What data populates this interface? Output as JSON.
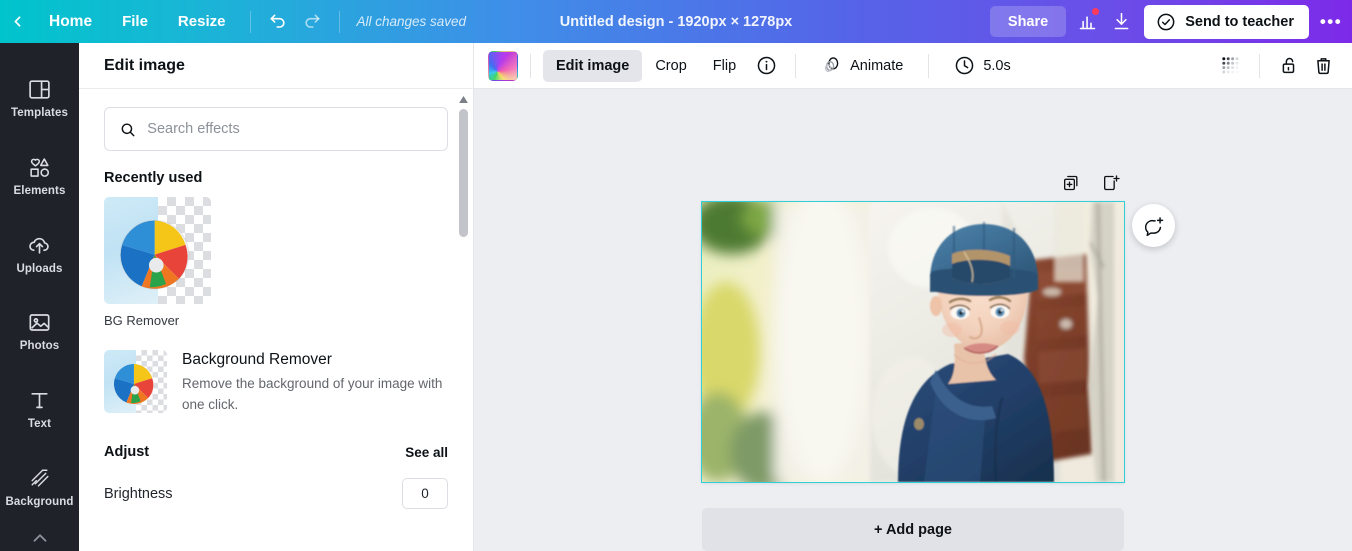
{
  "topbar": {
    "back_label": "back-chevron",
    "home_label": "Home",
    "file_label": "File",
    "resize_label": "Resize",
    "undo_label": "undo-icon",
    "redo_label": "redo-icon",
    "save_status": "All changes saved",
    "design_title": "Untitled design - 1920px × 1278px",
    "share_label": "Share",
    "insights_label": "insights-icon",
    "download_label": "download-icon",
    "send_to_teacher_label": "Send to teacher",
    "more_label": "•••",
    "gradient_start": "#00c4cc",
    "gradient_end": "#7d2ae8",
    "notification_color": "#ff3b5c"
  },
  "rail": {
    "items": [
      {
        "label": "Templates",
        "icon": "templates-icon"
      },
      {
        "label": "Elements",
        "icon": "elements-icon"
      },
      {
        "label": "Uploads",
        "icon": "uploads-icon"
      },
      {
        "label": "Photos",
        "icon": "photos-icon"
      },
      {
        "label": "Text",
        "icon": "text-icon"
      },
      {
        "label": "Background",
        "icon": "background-icon"
      }
    ]
  },
  "panel": {
    "title": "Edit image",
    "search_placeholder": "Search effects",
    "search_value": "",
    "recently_used_title": "Recently used",
    "recent_items": [
      {
        "label": "BG Remover"
      }
    ],
    "effects": [
      {
        "title": "Background Remover",
        "description": "Remove the background of your image with one click."
      }
    ],
    "adjust": {
      "title": "Adjust",
      "see_all_label": "See all",
      "controls": [
        {
          "label": "Brightness",
          "value": "0"
        }
      ]
    }
  },
  "toolbar": {
    "color_swatch_label": "color-swatch",
    "edit_image_label": "Edit image",
    "crop_label": "Crop",
    "flip_label": "Flip",
    "info_label": "info-icon",
    "animate_label": "Animate",
    "duration_label": "5.0s",
    "transparency_label": "transparency-icon",
    "lock_label": "unlock-icon",
    "delete_label": "delete-icon"
  },
  "canvas": {
    "duplicate_page_label": "duplicate-page-icon",
    "add_page_tool_label": "add-page-icon",
    "comment_label": "add-comment-icon",
    "add_page_label": "+ Add page",
    "selection_color": "#2ecfd6",
    "page_width": "422",
    "page_height": "280"
  }
}
